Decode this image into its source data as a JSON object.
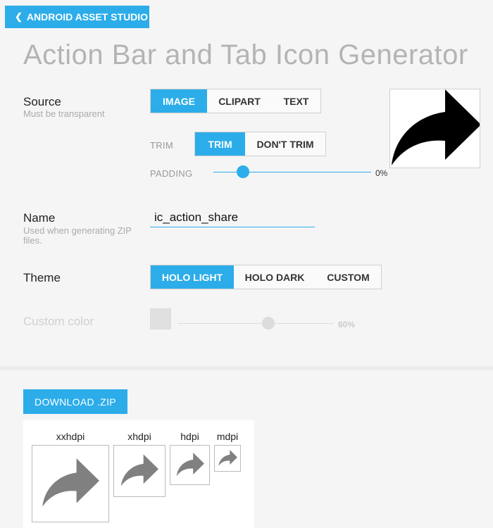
{
  "header": {
    "back_label": "ANDROID ASSET STUDIO",
    "title": "Action Bar and Tab Icon Generator"
  },
  "source": {
    "label": "Source",
    "hint": "Must be transparent",
    "options": [
      "IMAGE",
      "CLIPART",
      "TEXT"
    ],
    "selected": "IMAGE",
    "trim": {
      "label": "TRIM",
      "options": [
        "TRIM",
        "DON'T TRIM"
      ],
      "selected": "TRIM"
    },
    "padding": {
      "label": "PADDING",
      "value": "0%",
      "level": 0.18
    },
    "preview_icon": "share-arrow-icon"
  },
  "name": {
    "label": "Name",
    "hint": "Used when generating ZIP files.",
    "value": "ic_action_share"
  },
  "theme": {
    "label": "Theme",
    "options": [
      "HOLO LIGHT",
      "HOLO DARK",
      "CUSTOM"
    ],
    "selected": "HOLO LIGHT"
  },
  "custom_color": {
    "label": "Custom color",
    "value": "60%",
    "level": 0.6
  },
  "download": {
    "label": "DOWNLOAD .ZIP"
  },
  "outputs": [
    {
      "density": "xxhdpi"
    },
    {
      "density": "xhdpi"
    },
    {
      "density": "hdpi"
    },
    {
      "density": "mdpi"
    }
  ],
  "colors": {
    "accent": "#2cadea",
    "icon_preview": "#000000",
    "icon_output": "#808080"
  }
}
